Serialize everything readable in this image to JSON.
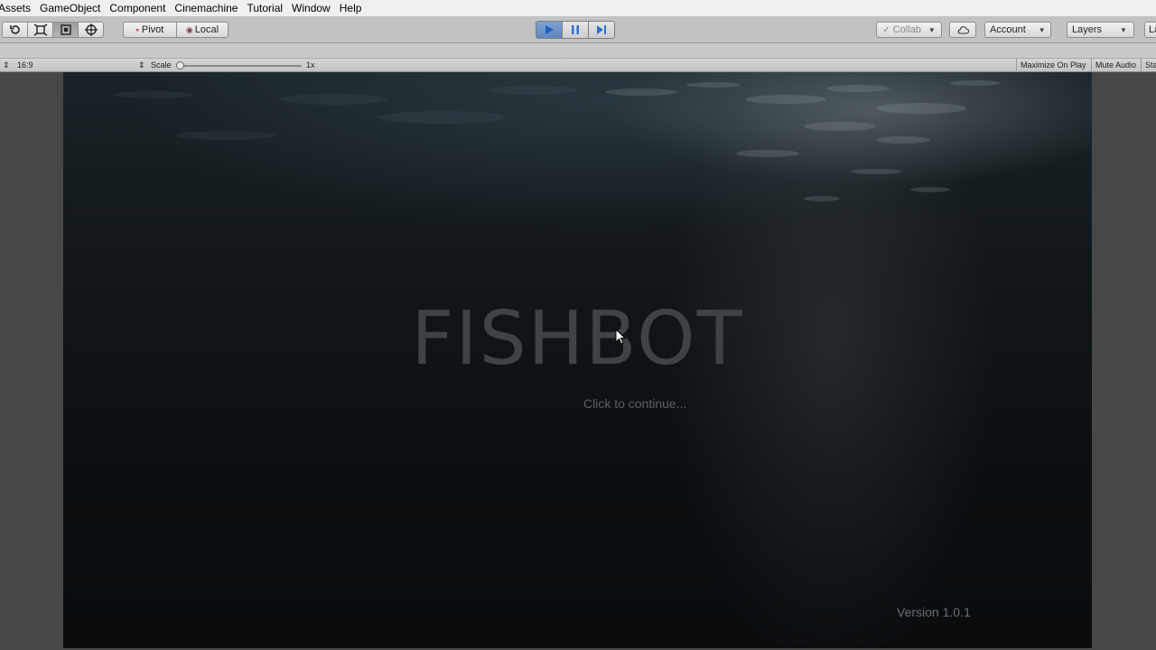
{
  "menu": {
    "items": [
      "Assets",
      "GameObject",
      "Component",
      "Cinemachine",
      "Tutorial",
      "Window",
      "Help"
    ]
  },
  "toolbar": {
    "tools": [
      "refresh-tool",
      "rect-tool",
      "transform-tool",
      "custom-tool"
    ],
    "pivot_label": "Pivot",
    "local_label": "Local",
    "collab_label": "Collab",
    "account_label": "Account",
    "layers_label": "Layers",
    "layout_label": "La"
  },
  "gamebar": {
    "aspect": "16:9",
    "scale_label": "Scale",
    "scale_value": "1x",
    "maximize_label": "Maximize On Play",
    "mute_label": "Mute Audio",
    "stats_label": "Sta"
  },
  "game": {
    "title": "FISHBOT",
    "subtitle": "Click to continue...",
    "version": "Version 1.0.1"
  }
}
